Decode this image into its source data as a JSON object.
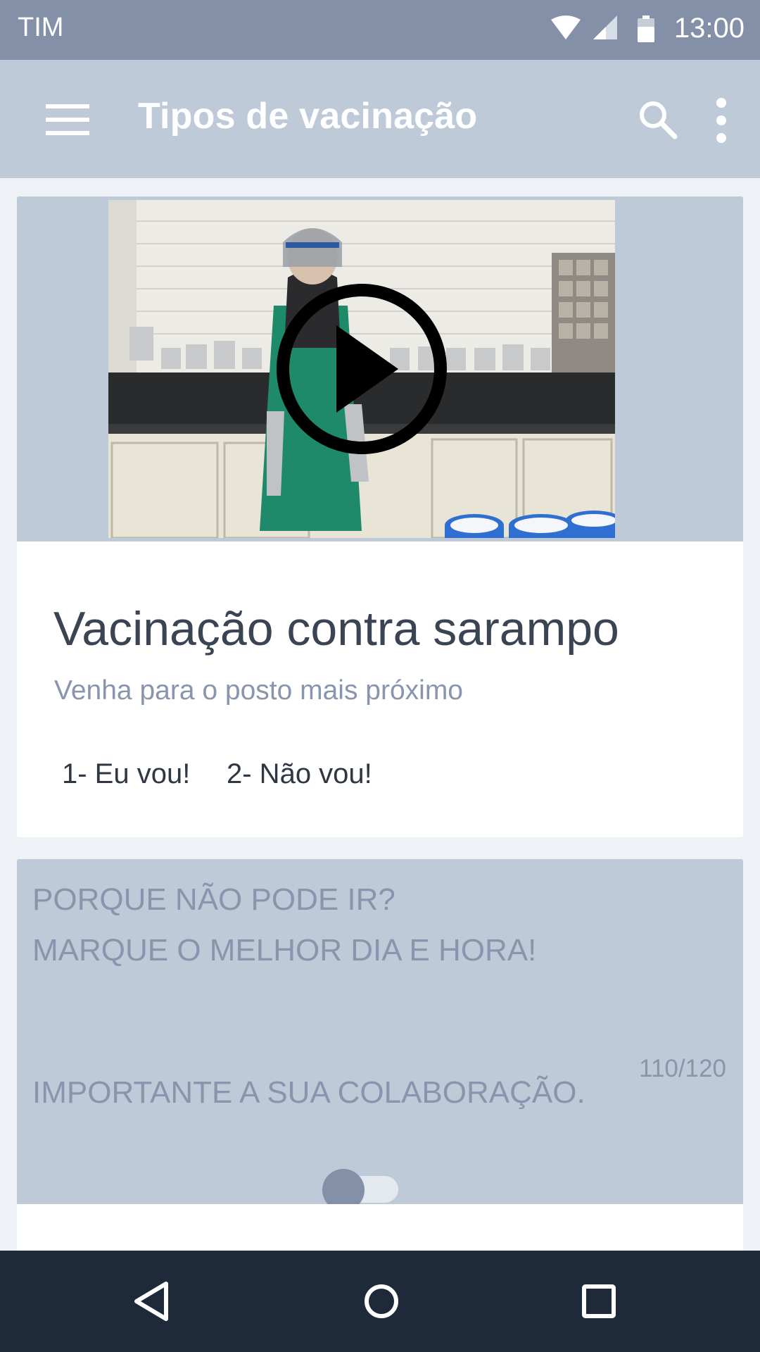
{
  "status_bar": {
    "carrier": "TIM",
    "time": "13:00",
    "icons": [
      "wifi-icon",
      "signal-icon",
      "battery-icon"
    ]
  },
  "app_bar": {
    "title": "Tipos de vacinação",
    "icons": [
      "menu-icon",
      "search-icon",
      "more-vert-icon"
    ]
  },
  "card": {
    "media": {
      "type": "video",
      "icon": "play-icon"
    },
    "title": "Vacinação contra sarampo",
    "subtitle": "Venha para o posto mais próximo",
    "actions": [
      "1- Eu vou!",
      "2- Não vou!"
    ]
  },
  "form": {
    "lines": [
      "PORQUE NÃO PODE IR?",
      "MARQUE O MELHOR DIA E HORA!",
      "",
      "",
      "IMPORTANTE A SUA COLABORAÇÃO."
    ],
    "counter": "110/120",
    "toggle_on": false
  },
  "nav_bar": {
    "icons": [
      "back-icon",
      "home-icon",
      "recents-icon"
    ]
  },
  "colors": {
    "status_bar": "#8390a8",
    "app_bar": "#bfcad9",
    "nav_bar": "#1e2a3a",
    "accent_text": "#8895ad"
  }
}
